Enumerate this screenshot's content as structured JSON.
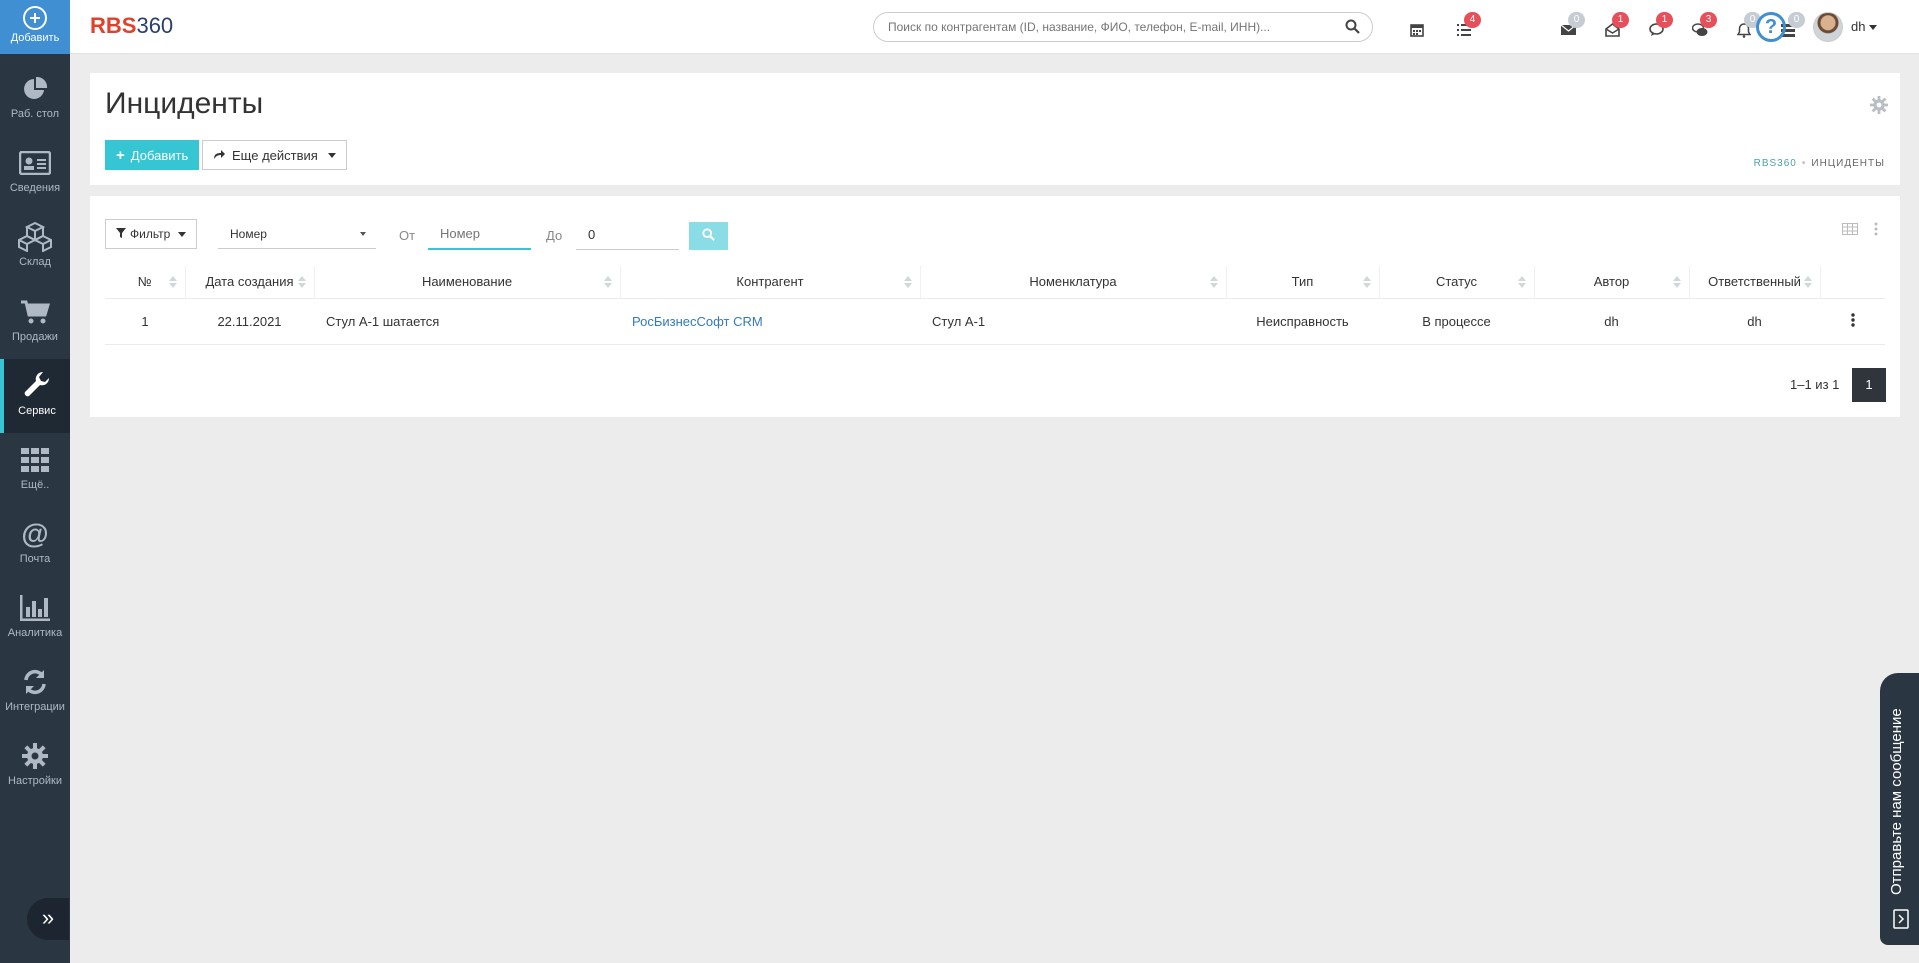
{
  "sidebar": {
    "add_label": "Добавить",
    "items": [
      {
        "label": "Раб. стол",
        "icon": "pie-chart-icon"
      },
      {
        "label": "Сведения",
        "icon": "id-card-icon"
      },
      {
        "label": "Склад",
        "icon": "cubes-icon"
      },
      {
        "label": "Продажи",
        "icon": "cart-icon"
      },
      {
        "label": "Сервис",
        "icon": "wrench-icon",
        "active": true
      },
      {
        "label": "Ещё..",
        "icon": "grid-icon"
      },
      {
        "label": "Почта",
        "icon": "at-icon"
      },
      {
        "label": "Аналитика",
        "icon": "bar-chart-icon"
      },
      {
        "label": "Интеграции",
        "icon": "refresh-icon"
      },
      {
        "label": "Настройки",
        "icon": "gear-icon"
      }
    ],
    "toggle_icon": "double-chevron-right-icon"
  },
  "header": {
    "logo_red": "RBS",
    "logo_blue": "360",
    "search_placeholder": "Поиск по контрагентам (ID, название, ФИО, телефон, E-mail, ИНН)...",
    "badges": {
      "tasks": "4",
      "mail": "0",
      "inbox": "1",
      "comments": "1",
      "chats": "3",
      "notifications": "0",
      "queue": "0"
    },
    "user": "dh"
  },
  "page": {
    "title": "Инциденты",
    "add_button": "Добавить",
    "more_button": "Еще действия",
    "breadcrumb": {
      "home": "RBS360",
      "current": "ИНЦИДЕНТЫ"
    }
  },
  "filter": {
    "button": "Фильтр",
    "field": "Номер",
    "from_label": "От",
    "from_placeholder": "Номер",
    "to_label": "До",
    "to_value": "0"
  },
  "table": {
    "columns": [
      "№",
      "Дата создания",
      "Наименование",
      "Контрагент",
      "Номенклатура",
      "Тип",
      "Статус",
      "Автор",
      "Ответственный"
    ],
    "rows": [
      {
        "num": "1",
        "date": "22.11.2021",
        "name": "Стул А-1 шатается",
        "contractor": "РосБизнесСофт CRM",
        "nomenclature": "Стул А-1",
        "type": "Неисправность",
        "status": "В процессе",
        "author": "dh",
        "responsible": "dh"
      }
    ]
  },
  "pager": {
    "info": "1–1 из 1",
    "current": "1"
  },
  "feedback": {
    "label": "Отправьте нам сообщение"
  },
  "colors": {
    "sidebar": "#2b3643",
    "accent": "#36c6d3",
    "primary": "#3f8fd2",
    "badge_red": "#e7505a"
  }
}
